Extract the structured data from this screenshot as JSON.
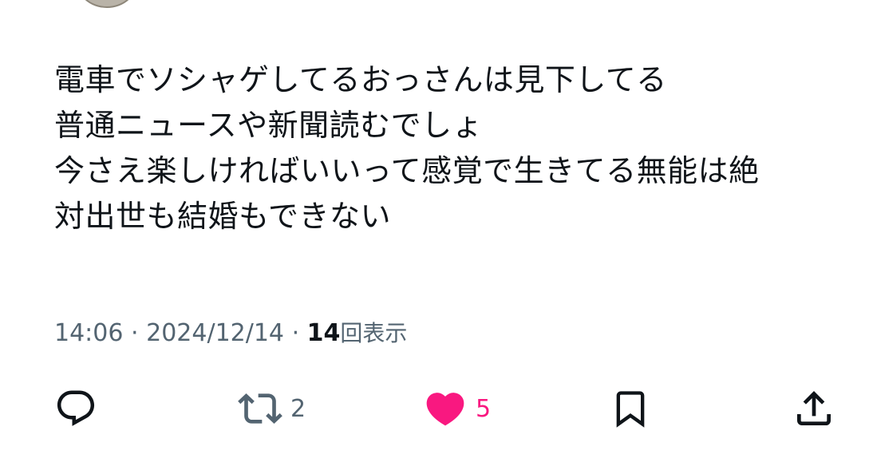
{
  "tweet": {
    "lines": [
      "電車でソシャゲしてるおっさんは見下してる",
      "普通ニュースや新聞読むでしょ",
      "今さえ楽しければいいって感覚で生きてる無能は絶",
      "対出世も結婚もできない"
    ]
  },
  "meta": {
    "time": "14:06",
    "separator": "·",
    "date": "2024/12/14",
    "views_count": "14",
    "views_label": "回表示"
  },
  "actions": {
    "reply": {
      "icon": "reply-icon"
    },
    "retweet": {
      "icon": "retweet-icon",
      "count": "2"
    },
    "like": {
      "icon": "heart-icon",
      "count": "5",
      "liked": true
    },
    "bookmark": {
      "icon": "bookmark-icon"
    },
    "share": {
      "icon": "share-icon"
    }
  },
  "colors": {
    "text": "#0f1419",
    "muted": "#536471",
    "like": "#f91880"
  }
}
